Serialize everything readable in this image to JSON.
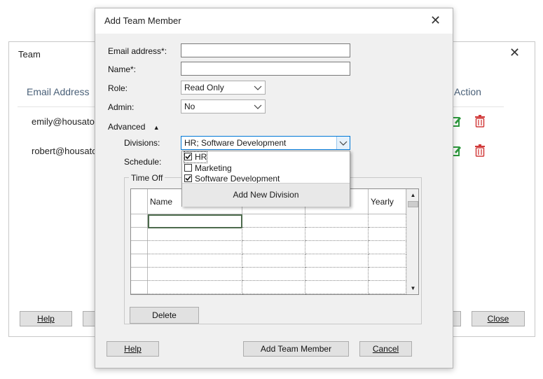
{
  "team_window": {
    "title": "Team",
    "close_glyph": "✕",
    "columns": {
      "email": "Email Address",
      "action": "Action"
    },
    "rows": [
      {
        "email": "emily@housato"
      },
      {
        "email": "robert@housato"
      }
    ],
    "help_label": "Help",
    "close_label": "Close",
    "edit_icon": "edit-icon",
    "delete_icon": "trash-icon",
    "colors": {
      "edit": "#2e9a3e",
      "delete": "#d13a3a",
      "header_text": "#4a6078"
    }
  },
  "dialog": {
    "title": "Add Team Member",
    "close_glyph": "✕",
    "email_label": "Email address*:",
    "email_value": "",
    "name_label": "Name*:",
    "name_value": "",
    "role_label": "Role:",
    "role_value": "Read Only",
    "admin_label": "Admin:",
    "admin_value": "No",
    "advanced_label": "Advanced",
    "advanced_glyph": "▲",
    "divisions_label": "Divisions:",
    "divisions_value": "HR; Software Development",
    "schedule_label": "Schedule:",
    "time_off": {
      "legend": "Time Off",
      "columns": [
        "Name",
        "",
        "",
        "Yearly"
      ],
      "delete_label": "Delete"
    },
    "divisions_dropdown": {
      "items": [
        {
          "label": "HR",
          "checked": true
        },
        {
          "label": "Marketing",
          "checked": false
        },
        {
          "label": "Software Development",
          "checked": true
        }
      ],
      "add_label": "Add New Division"
    },
    "help_label": "Help",
    "submit_label": "Add Team Member",
    "cancel_label": "Cancel",
    "colors": {
      "focus_border": "#0078d7",
      "dialog_bg": "#f0f0f0"
    }
  }
}
